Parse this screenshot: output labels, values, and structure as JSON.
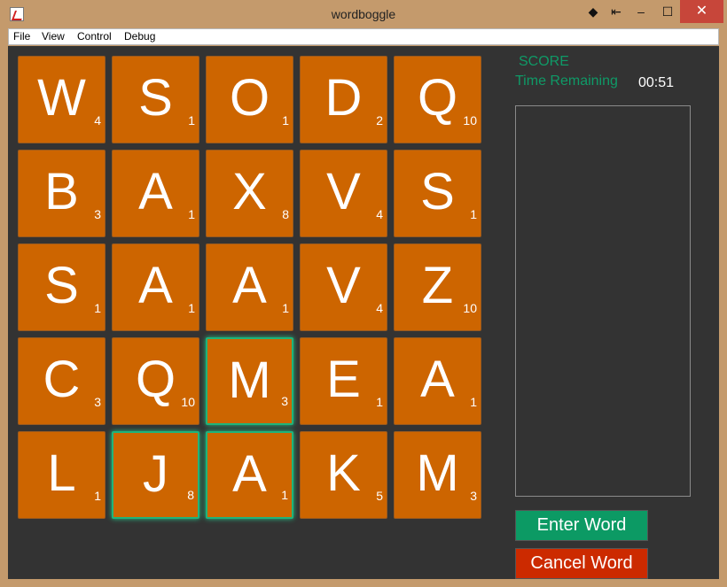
{
  "window": {
    "title": "wordboggle"
  },
  "titlebar_controls": [
    "◆",
    "⇤",
    "–",
    "☐",
    "✕"
  ],
  "menu": [
    "File",
    "View",
    "Control",
    "Debug"
  ],
  "board": [
    [
      {
        "letter": "W",
        "points": "4",
        "selected": false
      },
      {
        "letter": "S",
        "points": "1",
        "selected": false
      },
      {
        "letter": "O",
        "points": "1",
        "selected": false
      },
      {
        "letter": "D",
        "points": "2",
        "selected": false
      },
      {
        "letter": "Q",
        "points": "10",
        "selected": false
      }
    ],
    [
      {
        "letter": "B",
        "points": "3",
        "selected": false
      },
      {
        "letter": "A",
        "points": "1",
        "selected": false
      },
      {
        "letter": "X",
        "points": "8",
        "selected": false
      },
      {
        "letter": "V",
        "points": "4",
        "selected": false
      },
      {
        "letter": "S",
        "points": "1",
        "selected": false
      }
    ],
    [
      {
        "letter": "S",
        "points": "1",
        "selected": false
      },
      {
        "letter": "A",
        "points": "1",
        "selected": false
      },
      {
        "letter": "A",
        "points": "1",
        "selected": false
      },
      {
        "letter": "V",
        "points": "4",
        "selected": false
      },
      {
        "letter": "Z",
        "points": "10",
        "selected": false
      }
    ],
    [
      {
        "letter": "C",
        "points": "3",
        "selected": false
      },
      {
        "letter": "Q",
        "points": "10",
        "selected": false
      },
      {
        "letter": "M",
        "points": "3",
        "selected": true
      },
      {
        "letter": "E",
        "points": "1",
        "selected": false
      },
      {
        "letter": "A",
        "points": "1",
        "selected": false
      }
    ],
    [
      {
        "letter": "L",
        "points": "1",
        "selected": false
      },
      {
        "letter": "J",
        "points": "8",
        "selected": true
      },
      {
        "letter": "A",
        "points": "1",
        "selected": true
      },
      {
        "letter": "K",
        "points": "5",
        "selected": false
      },
      {
        "letter": "M",
        "points": "3",
        "selected": false
      }
    ]
  ],
  "score": {
    "label": "SCORE"
  },
  "timer": {
    "label": "Time Remaining",
    "value": "00:51"
  },
  "buttons": {
    "enter": "Enter Word",
    "cancel": "Cancel Word"
  },
  "colors": {
    "tile": "#cd6500",
    "selected_glow": "#22c487",
    "accent_green": "#0c9a64",
    "cancel_red": "#cc2a00",
    "panel": "#333333"
  }
}
